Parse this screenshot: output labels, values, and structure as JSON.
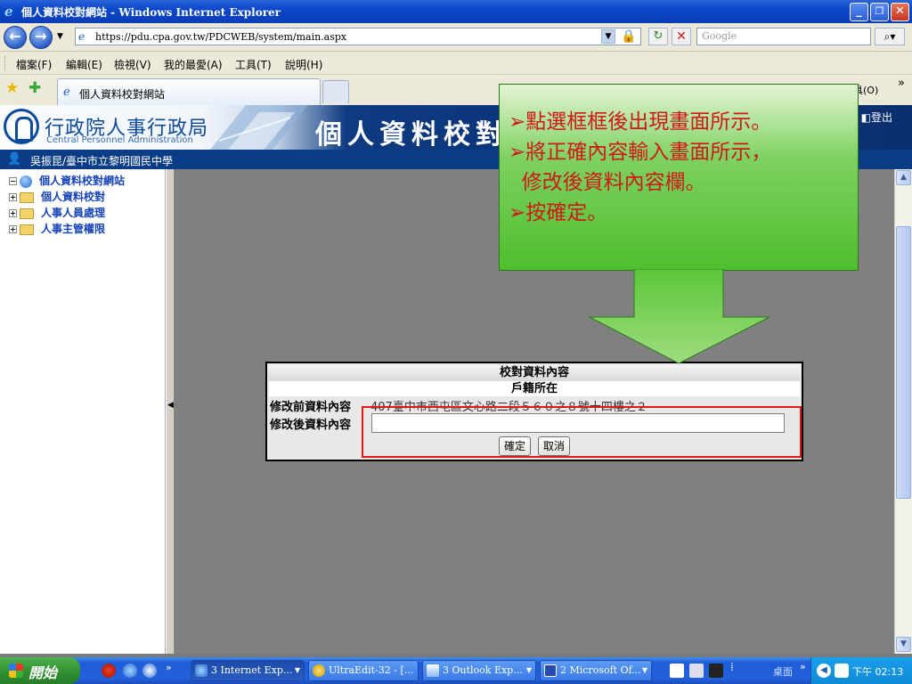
{
  "window": {
    "title": "個人資料校對網站 - Windows Internet Explorer",
    "minimize": "_",
    "restore": "❐",
    "close": "✕"
  },
  "address": {
    "url": "https://pdu.cpa.gov.tw/PDCWEB/system/main.aspx",
    "search_placeholder": "Google"
  },
  "menu": {
    "items": [
      "檔案(F)",
      "編輯(E)",
      "檢視(V)",
      "我的最愛(A)",
      "工具(T)",
      "說明(H)"
    ]
  },
  "tabs": {
    "active_label": "個人資料校對網站",
    "tools_label": "具(O)",
    "chevron": "»"
  },
  "header": {
    "org_zh": "行政院人事行政局",
    "org_en": "Central Personnel Administration",
    "site_title": "個人資料校對網",
    "logout": "登出"
  },
  "user": {
    "name": "吳振昆/臺中市立黎明國民中學"
  },
  "sidebar": {
    "root": "個人資料校對網站",
    "items": [
      "個人資料校對",
      "人事人員處理",
      "人事主管權限"
    ]
  },
  "form": {
    "title": "校對資料內容",
    "section": "戶籍所在",
    "before_label": "修改前資料內容",
    "before_value": "407臺中市西屯區文心路二段５６０之８號十四樓之２",
    "after_label": "修改後資料內容",
    "after_value": "",
    "confirm": "確定",
    "cancel": "取消"
  },
  "callout": {
    "lines": [
      "➢點選框框後出現畫面所示。",
      "➢將正確內容輸入畫面所示，",
      "  修改後資料內容欄。",
      "➢按確定。"
    ]
  },
  "taskbar": {
    "start": "開始",
    "items": [
      {
        "label": "3 Internet Exp..."
      },
      {
        "label": "UltraEdit-32 - [..."
      },
      {
        "label": "3 Outlook Exp..."
      },
      {
        "label": "2 Microsoft Of..."
      }
    ],
    "desktop": "桌面",
    "clock": "下午 02:13"
  },
  "colors": {
    "accent_blue": "#0b3c86",
    "callout_green": "#4fbe2e",
    "callout_text": "#d01818",
    "highlight_frame": "#e01818"
  }
}
